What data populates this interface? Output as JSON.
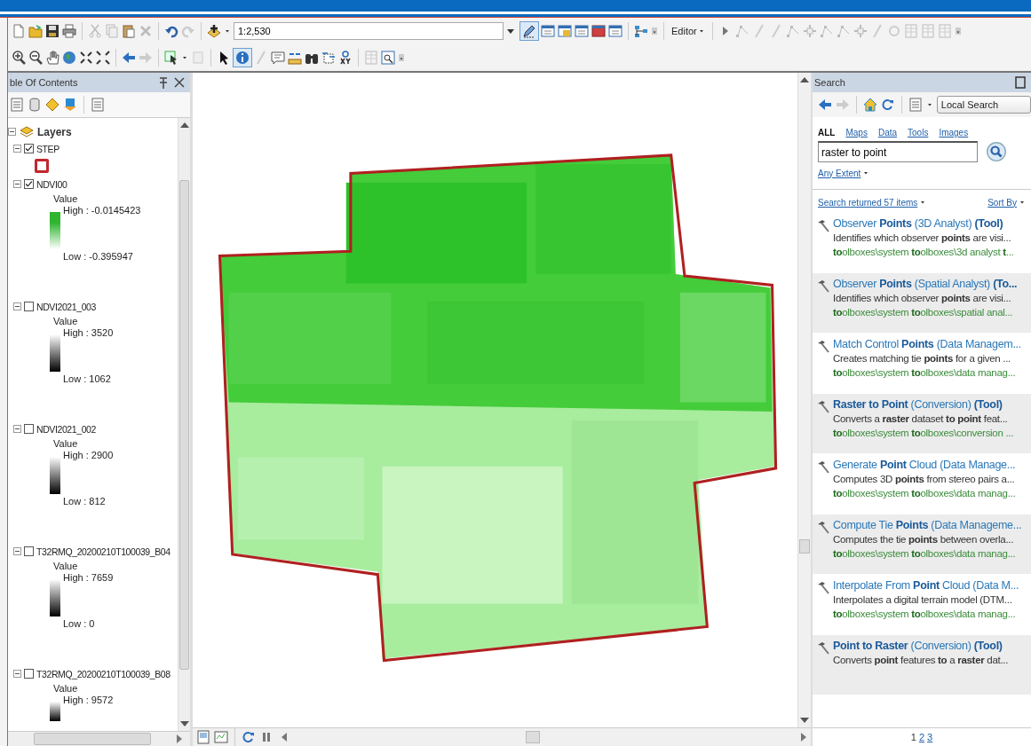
{
  "toolbar": {
    "scale": "1:2,530",
    "editor_menu": "Editor"
  },
  "toc": {
    "title": "ble Of Contents",
    "tree": {
      "label": "Layers",
      "expanded": true,
      "children": [
        {
          "name": "STEP",
          "kind": "polygon",
          "checked": true,
          "expanded": true,
          "color": "#c0272d"
        },
        {
          "name": "NDVI00",
          "kind": "color_ramp",
          "checked": true,
          "expanded": true,
          "legend_title": "Value",
          "high": "High : -0.0145423",
          "low": "Low : -0.395947",
          "color": "#2fb52f"
        },
        {
          "name": "NDVI2021_003",
          "kind": "grayscale",
          "checked": false,
          "expanded": true,
          "legend_title": "Value",
          "high": "High : 3520",
          "low": "Low : 1062"
        },
        {
          "name": "NDVI2021_002",
          "kind": "grayscale",
          "checked": false,
          "expanded": true,
          "legend_title": "Value",
          "high": "High : 2900",
          "low": "Low : 812"
        },
        {
          "name": "T32RMQ_20200210T100039_B04",
          "kind": "grayscale",
          "checked": false,
          "expanded": true,
          "legend_title": "Value",
          "high": "High : 7659",
          "low": "Low : 0"
        },
        {
          "name": "T32RMQ_20200210T100039_B08",
          "kind": "grayscale",
          "checked": false,
          "expanded": true,
          "legend_title": "Value",
          "high": "High : 9572"
        }
      ]
    }
  },
  "search": {
    "title": "Search",
    "scope": "Local Search",
    "filters": [
      {
        "label": "ALL",
        "selected": true
      },
      {
        "label": "Maps",
        "selected": false
      },
      {
        "label": "Data",
        "selected": false
      },
      {
        "label": "Tools",
        "selected": false
      },
      {
        "label": "Images",
        "selected": false
      }
    ],
    "query": "raster to point",
    "extent": "Any Extent",
    "summary": "Search returned 57 items",
    "sort": "Sort By",
    "results": [
      {
        "title": "Observer **Points** (3D Analyst) **(Tool)**",
        "description": "Identifies which observer **points** are visi...",
        "path": "**to**olboxes\\system **to**olboxes\\3d analyst **t**..."
      },
      {
        "title": "Observer **Points** (Spatial Analyst) **(To...**",
        "description": "Identifies which observer **points** are visi...",
        "path": "**to**olboxes\\system **to**olboxes\\spatial anal..."
      },
      {
        "title": "Match Control **Points** (Data Managem...",
        "description": "Creates matching tie **points** for a given ...",
        "path": "**to**olboxes\\system **to**olboxes\\data manag..."
      },
      {
        "title": "**Raster to Point** (Conversion) **(Tool)**",
        "description": "Converts a **raster** dataset **to point** feat...",
        "path": "**to**olboxes\\system **to**olboxes\\conversion ..."
      },
      {
        "title": "Generate **Point** Cloud (Data Manage...",
        "description": "Computes 3D **points** from stereo pairs a...",
        "path": "**to**olboxes\\system **to**olboxes\\data manag..."
      },
      {
        "title": "Compute Tie **Points** (Data Manageme...",
        "description": "Computes the tie **points** between overla...",
        "path": "**to**olboxes\\system **to**olboxes\\data manag..."
      },
      {
        "title": "Interpolate From **Point** Cloud (Data M...",
        "description": "Interpolates a digital terrain model (DTM...",
        "path": "**to**olboxes\\system **to**olboxes\\data manag..."
      },
      {
        "title": "**Point to Raster** (Conversion) **(Tool)**",
        "description": "Converts **point** features **to** a **raster** dat..."
      }
    ],
    "pages": [
      {
        "label": "1",
        "selected": true
      },
      {
        "label": "2",
        "selected": false
      },
      {
        "label": "3",
        "selected": false
      }
    ]
  }
}
